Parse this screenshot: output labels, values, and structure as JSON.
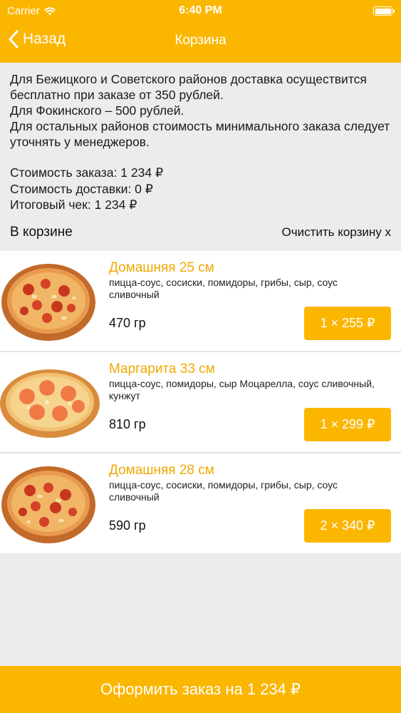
{
  "status": {
    "carrier": "Carrier",
    "time": "6:40 PM",
    "battery_level": 1.0
  },
  "nav": {
    "back_label": "Назад",
    "title": "Корзина"
  },
  "info": {
    "lines": [
      "Для Бежицкого и Советского районов доставка осуществится бесплатно при заказе от 350 рублей.",
      "Для Фокинского – 500 рублей.",
      "Для остальных районов стоимость минимального заказа следует уточнять у менеджеров."
    ]
  },
  "costs": {
    "order": "Стоимость заказа: 1 234 ₽",
    "delivery": "Стоимость доставки: 0 ₽",
    "total": "Итоговый чек: 1 234 ₽"
  },
  "cart": {
    "label": "В корзине",
    "clear_label": "Очистить корзину x"
  },
  "items": [
    {
      "title": "Домашняя 25 см",
      "description": "пицца-соус, сосиски, помидоры, грибы, сыр, соус сливочный",
      "weight": "470 гр",
      "quantity_price": "1 × 255 ₽"
    },
    {
      "title": "Маргарита 33 см",
      "description": "пицца-соус, помидоры, сыр Моцарелла, соус сливочный, кунжут",
      "weight": "810 гр",
      "quantity_price": "1 × 299 ₽"
    },
    {
      "title": "Домашняя 28 см",
      "description": "пицца-соус, сосиски, помидоры, грибы, сыр, соус сливочный",
      "weight": "590 гр",
      "quantity_price": "2 × 340 ₽"
    }
  ],
  "order_button": "Оформить заказ на 1 234 ₽",
  "colors": {
    "accent": "#fbb600",
    "title_text": "#f0a800",
    "background": "#ececec"
  }
}
